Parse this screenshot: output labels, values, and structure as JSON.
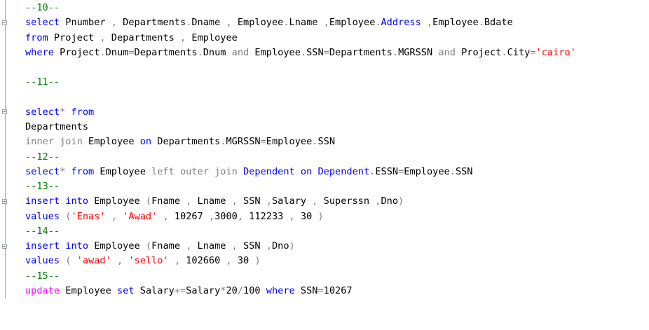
{
  "editor": {
    "lines": [
      {
        "tokens": [
          {
            "t": "--10--",
            "c": "cm"
          }
        ]
      },
      {
        "tokens": [
          {
            "t": "select",
            "c": "kw"
          },
          {
            "t": " Pnumber ",
            "c": "pl"
          },
          {
            "t": ",",
            "c": "op"
          },
          {
            "t": " Departments",
            "c": "pl"
          },
          {
            "t": ".",
            "c": "op"
          },
          {
            "t": "Dname ",
            "c": "pl"
          },
          {
            "t": ",",
            "c": "op"
          },
          {
            "t": " Employee",
            "c": "pl"
          },
          {
            "t": ".",
            "c": "op"
          },
          {
            "t": "Lname ",
            "c": "pl"
          },
          {
            "t": ",",
            "c": "op"
          },
          {
            "t": "Employee",
            "c": "pl"
          },
          {
            "t": ".",
            "c": "op"
          },
          {
            "t": "Address",
            "c": "kw"
          },
          {
            "t": " ",
            "c": "pl"
          },
          {
            "t": ",",
            "c": "op"
          },
          {
            "t": "Employee",
            "c": "pl"
          },
          {
            "t": ".",
            "c": "op"
          },
          {
            "t": "Bdate",
            "c": "pl"
          }
        ]
      },
      {
        "tokens": [
          {
            "t": "from",
            "c": "kw"
          },
          {
            "t": " Project ",
            "c": "pl"
          },
          {
            "t": ",",
            "c": "op"
          },
          {
            "t": " Departments ",
            "c": "pl"
          },
          {
            "t": ",",
            "c": "op"
          },
          {
            "t": " Employee",
            "c": "pl"
          }
        ]
      },
      {
        "tokens": [
          {
            "t": "where",
            "c": "kw"
          },
          {
            "t": " Project",
            "c": "pl"
          },
          {
            "t": ".",
            "c": "op"
          },
          {
            "t": "Dnum",
            "c": "pl"
          },
          {
            "t": "=",
            "c": "op"
          },
          {
            "t": "Departments",
            "c": "pl"
          },
          {
            "t": ".",
            "c": "op"
          },
          {
            "t": "Dnum ",
            "c": "pl"
          },
          {
            "t": "and",
            "c": "op"
          },
          {
            "t": " Employee",
            "c": "pl"
          },
          {
            "t": ".",
            "c": "op"
          },
          {
            "t": "SSN",
            "c": "pl"
          },
          {
            "t": "=",
            "c": "op"
          },
          {
            "t": "Departments",
            "c": "pl"
          },
          {
            "t": ".",
            "c": "op"
          },
          {
            "t": "MGRSSN ",
            "c": "pl"
          },
          {
            "t": "and",
            "c": "op"
          },
          {
            "t": " Project",
            "c": "pl"
          },
          {
            "t": ".",
            "c": "op"
          },
          {
            "t": "City",
            "c": "pl"
          },
          {
            "t": "=",
            "c": "op"
          },
          {
            "t": "'cairo'",
            "c": "str"
          }
        ]
      },
      {
        "tokens": []
      },
      {
        "tokens": [
          {
            "t": "--11--",
            "c": "cm"
          }
        ]
      },
      {
        "tokens": []
      },
      {
        "tokens": [
          {
            "t": "select",
            "c": "kw"
          },
          {
            "t": "*",
            "c": "op"
          },
          {
            "t": " from",
            "c": "kw"
          }
        ]
      },
      {
        "tokens": [
          {
            "t": "Departments",
            "c": "pl"
          }
        ]
      },
      {
        "tokens": [
          {
            "t": "inner",
            "c": "op"
          },
          {
            "t": " ",
            "c": "pl"
          },
          {
            "t": "join",
            "c": "op"
          },
          {
            "t": " Employee ",
            "c": "pl"
          },
          {
            "t": "on",
            "c": "kw"
          },
          {
            "t": " Departments",
            "c": "pl"
          },
          {
            "t": ".",
            "c": "op"
          },
          {
            "t": "MGRSSN",
            "c": "pl"
          },
          {
            "t": "=",
            "c": "op"
          },
          {
            "t": "Employee",
            "c": "pl"
          },
          {
            "t": ".",
            "c": "op"
          },
          {
            "t": "SSN",
            "c": "pl"
          }
        ]
      },
      {
        "tokens": [
          {
            "t": "--12--",
            "c": "cm"
          }
        ]
      },
      {
        "tokens": [
          {
            "t": "select",
            "c": "kw"
          },
          {
            "t": "*",
            "c": "op"
          },
          {
            "t": " from",
            "c": "kw"
          },
          {
            "t": " Employee ",
            "c": "pl"
          },
          {
            "t": "left",
            "c": "op"
          },
          {
            "t": " ",
            "c": "pl"
          },
          {
            "t": "outer",
            "c": "op"
          },
          {
            "t": " ",
            "c": "pl"
          },
          {
            "t": "join",
            "c": "op"
          },
          {
            "t": " ",
            "c": "pl"
          },
          {
            "t": "Dependent",
            "c": "kw"
          },
          {
            "t": " ",
            "c": "pl"
          },
          {
            "t": "on",
            "c": "kw"
          },
          {
            "t": " ",
            "c": "pl"
          },
          {
            "t": "Dependent",
            "c": "kw"
          },
          {
            "t": ".",
            "c": "op"
          },
          {
            "t": "ESSN",
            "c": "pl"
          },
          {
            "t": "=",
            "c": "op"
          },
          {
            "t": "Employee",
            "c": "pl"
          },
          {
            "t": ".",
            "c": "op"
          },
          {
            "t": "SSN",
            "c": "pl"
          }
        ]
      },
      {
        "tokens": [
          {
            "t": "--13--",
            "c": "cm"
          }
        ]
      },
      {
        "tokens": [
          {
            "t": "insert",
            "c": "kw"
          },
          {
            "t": " ",
            "c": "pl"
          },
          {
            "t": "into",
            "c": "kw"
          },
          {
            "t": " Employee ",
            "c": "pl"
          },
          {
            "t": "(",
            "c": "op"
          },
          {
            "t": "Fname ",
            "c": "pl"
          },
          {
            "t": ",",
            "c": "op"
          },
          {
            "t": " Lname ",
            "c": "pl"
          },
          {
            "t": ",",
            "c": "op"
          },
          {
            "t": " SSN ",
            "c": "pl"
          },
          {
            "t": ",",
            "c": "op"
          },
          {
            "t": "Salary ",
            "c": "pl"
          },
          {
            "t": ",",
            "c": "op"
          },
          {
            "t": " Superssn ",
            "c": "pl"
          },
          {
            "t": ",",
            "c": "op"
          },
          {
            "t": "Dno",
            "c": "pl"
          },
          {
            "t": ")",
            "c": "op"
          }
        ]
      },
      {
        "tokens": [
          {
            "t": "values",
            "c": "kw"
          },
          {
            "t": " ",
            "c": "pl"
          },
          {
            "t": "(",
            "c": "op"
          },
          {
            "t": "'Enas'",
            "c": "str"
          },
          {
            "t": " ",
            "c": "pl"
          },
          {
            "t": ",",
            "c": "op"
          },
          {
            "t": " ",
            "c": "pl"
          },
          {
            "t": "'Awad'",
            "c": "str"
          },
          {
            "t": " ",
            "c": "pl"
          },
          {
            "t": ",",
            "c": "op"
          },
          {
            "t": " 10267 ",
            "c": "pl"
          },
          {
            "t": ",",
            "c": "op"
          },
          {
            "t": "3000",
            "c": "pl"
          },
          {
            "t": ",",
            "c": "op"
          },
          {
            "t": " 112233 ",
            "c": "pl"
          },
          {
            "t": ",",
            "c": "op"
          },
          {
            "t": " 30 ",
            "c": "pl"
          },
          {
            "t": ")",
            "c": "op"
          }
        ]
      },
      {
        "tokens": [
          {
            "t": "--14--",
            "c": "cm"
          }
        ]
      },
      {
        "tokens": [
          {
            "t": "insert",
            "c": "kw"
          },
          {
            "t": " ",
            "c": "pl"
          },
          {
            "t": "into",
            "c": "kw"
          },
          {
            "t": " Employee ",
            "c": "pl"
          },
          {
            "t": "(",
            "c": "op"
          },
          {
            "t": "Fname ",
            "c": "pl"
          },
          {
            "t": ",",
            "c": "op"
          },
          {
            "t": " Lname ",
            "c": "pl"
          },
          {
            "t": ",",
            "c": "op"
          },
          {
            "t": " SSN ",
            "c": "pl"
          },
          {
            "t": ",",
            "c": "op"
          },
          {
            "t": "Dno",
            "c": "pl"
          },
          {
            "t": ")",
            "c": "op"
          }
        ]
      },
      {
        "tokens": [
          {
            "t": "values",
            "c": "kw"
          },
          {
            "t": " ",
            "c": "pl"
          },
          {
            "t": "(",
            "c": "op"
          },
          {
            "t": " ",
            "c": "pl"
          },
          {
            "t": "'awad'",
            "c": "str"
          },
          {
            "t": " ",
            "c": "pl"
          },
          {
            "t": ",",
            "c": "op"
          },
          {
            "t": " ",
            "c": "pl"
          },
          {
            "t": "'sello'",
            "c": "str"
          },
          {
            "t": " ",
            "c": "pl"
          },
          {
            "t": ",",
            "c": "op"
          },
          {
            "t": " 102660 ",
            "c": "pl"
          },
          {
            "t": ",",
            "c": "op"
          },
          {
            "t": " 30 ",
            "c": "pl"
          },
          {
            "t": ")",
            "c": "op"
          }
        ]
      },
      {
        "tokens": [
          {
            "t": "--15--",
            "c": "cm"
          }
        ]
      },
      {
        "tokens": [
          {
            "t": "update",
            "c": "fn"
          },
          {
            "t": " Employee ",
            "c": "pl"
          },
          {
            "t": "set",
            "c": "kw"
          },
          {
            "t": " Salary",
            "c": "pl"
          },
          {
            "t": "+=",
            "c": "op"
          },
          {
            "t": "Salary",
            "c": "pl"
          },
          {
            "t": "*",
            "c": "op"
          },
          {
            "t": "20",
            "c": "pl"
          },
          {
            "t": "/",
            "c": "op"
          },
          {
            "t": "100 ",
            "c": "pl"
          },
          {
            "t": "where",
            "c": "kw"
          },
          {
            "t": " SSN",
            "c": "pl"
          },
          {
            "t": "=",
            "c": "op"
          },
          {
            "t": "10267",
            "c": "pl"
          }
        ]
      }
    ]
  },
  "colors": {
    "keyword": "#0000ff",
    "operator": "#808080",
    "comment": "#008000",
    "string": "#ff0000",
    "function": "#ff00ff",
    "plain": "#000000"
  }
}
